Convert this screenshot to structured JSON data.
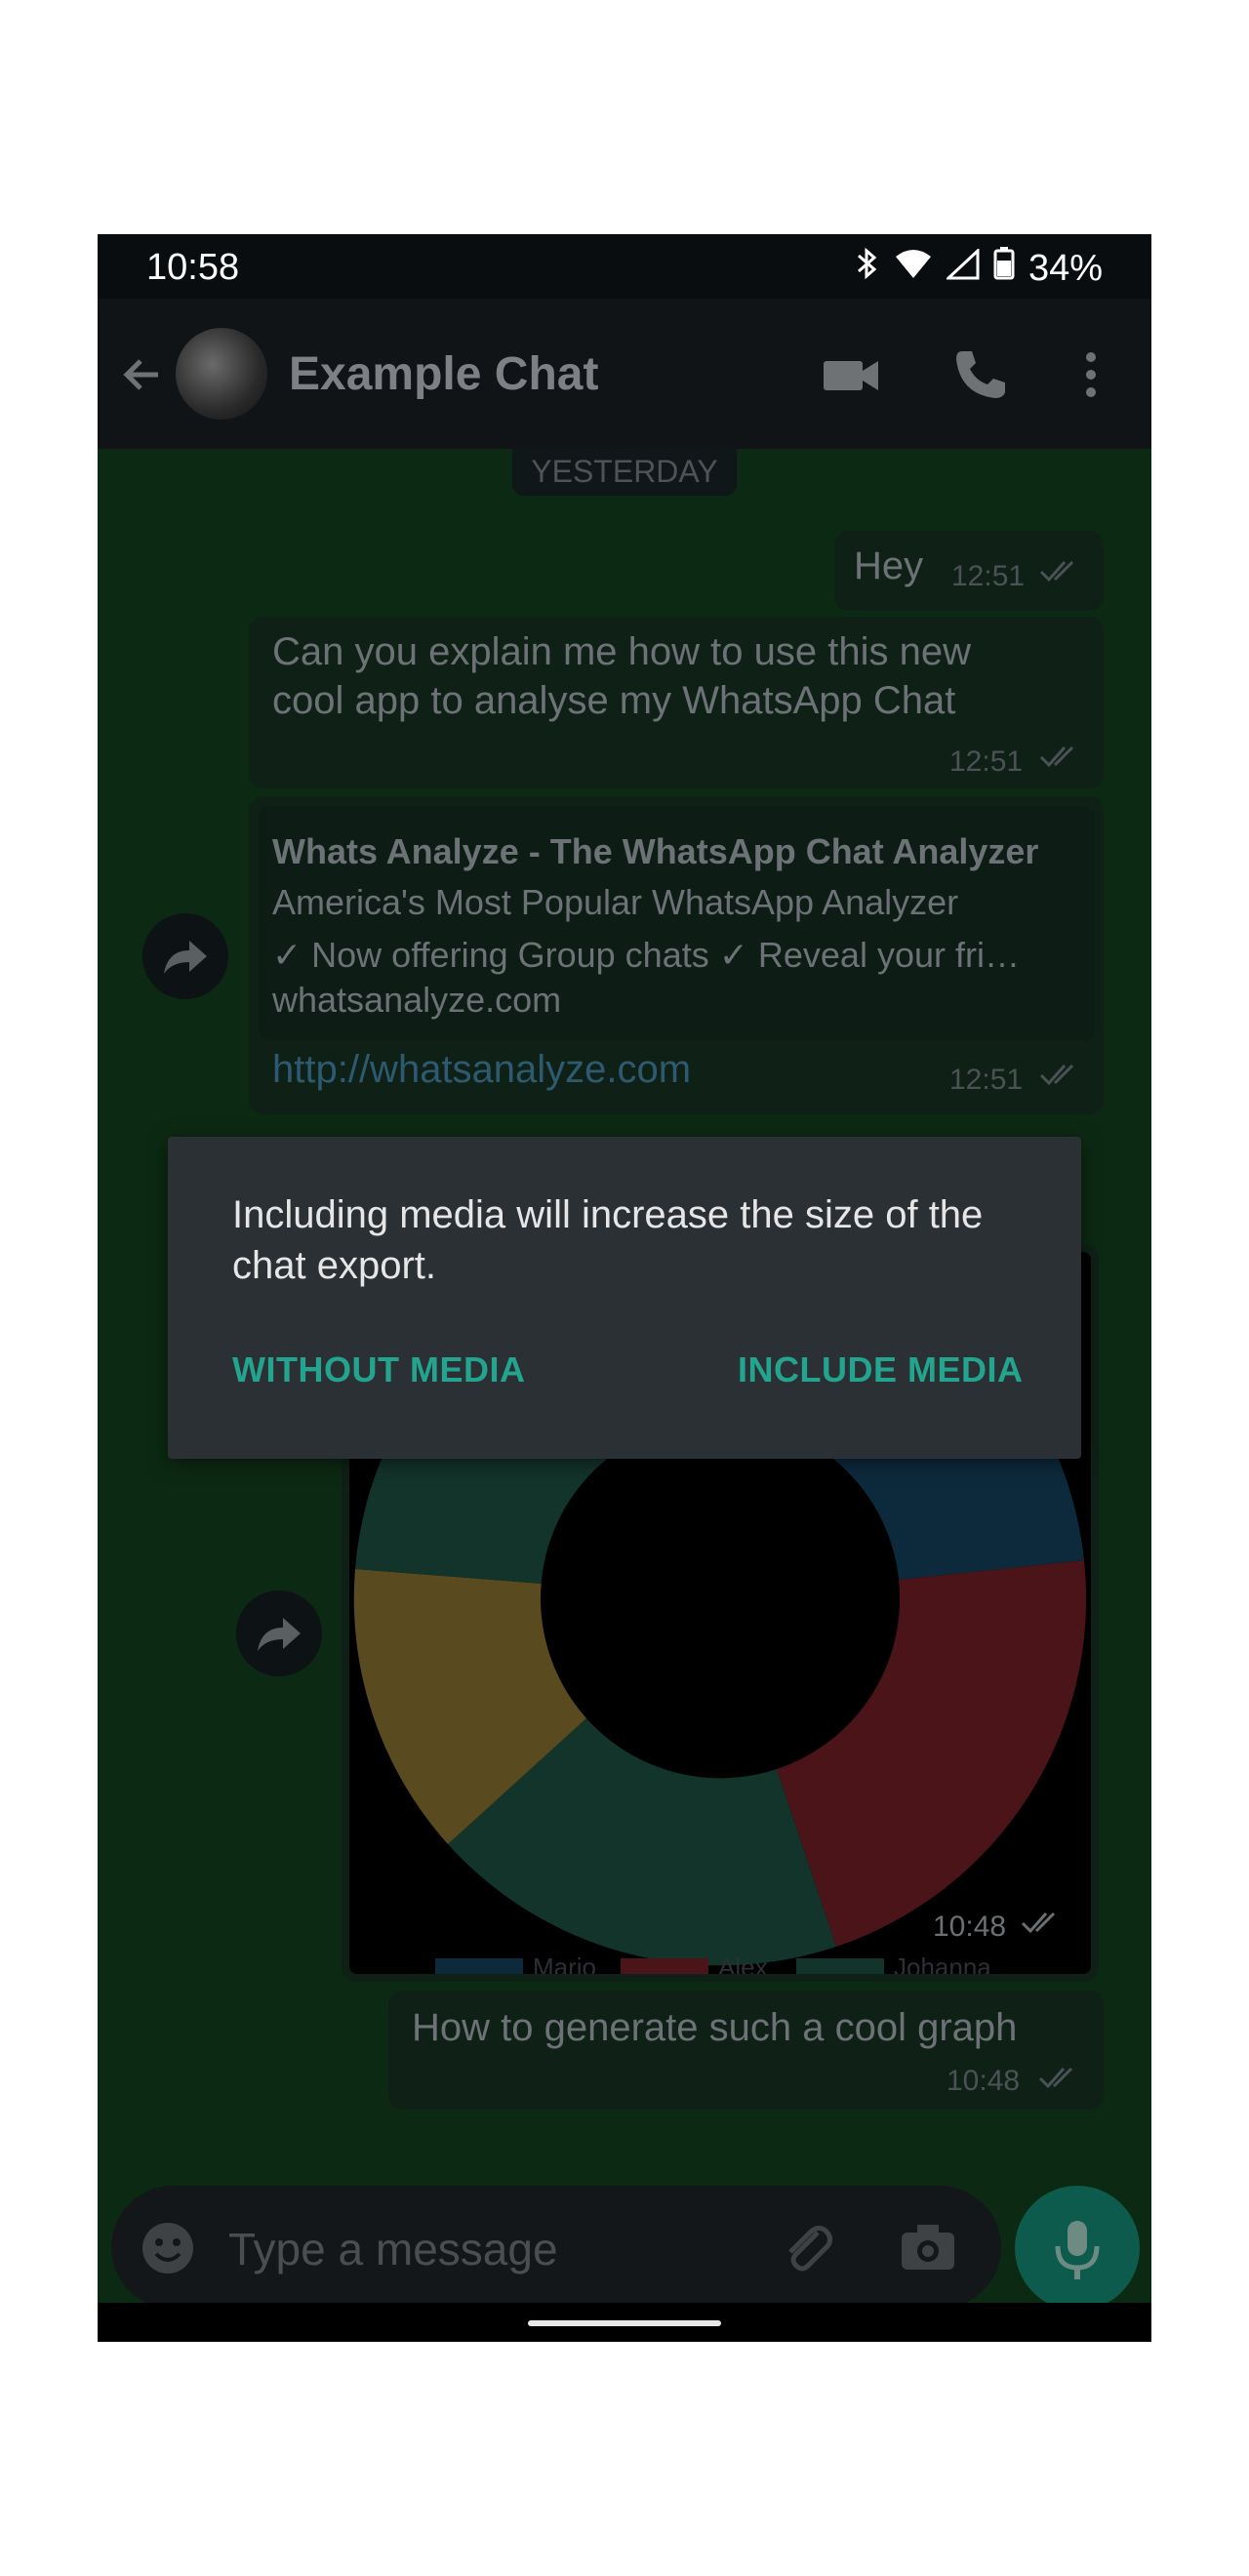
{
  "status": {
    "time": "10:58",
    "battery": "34%"
  },
  "header": {
    "title": "Example Chat"
  },
  "date_pill": "YESTERDAY",
  "messages": {
    "hey": {
      "text": "Hey",
      "time": "12:51"
    },
    "question": {
      "line1": "Can you explain me how to use this new",
      "line2": "cool app to analyse my WhatsApp Chat",
      "time": "12:51"
    },
    "link": {
      "title": "Whats Analyze - The WhatsApp Chat Analyzer",
      "subtitle": "America's Most Popular WhatsApp Analyzer",
      "description": "✓ Now offering Group chats ✓ Reveal your fri…",
      "domain": "whatsanalyze.com",
      "url": "http://whatsanalyze.com",
      "time": "12:51"
    },
    "image": {
      "time": "10:48",
      "legend": [
        "Mario",
        "Alex",
        "Johanna"
      ]
    },
    "graph_q": {
      "text": "How to generate such a cool graph",
      "time": "10:48"
    }
  },
  "dialog": {
    "message": "Including media will increase the size of the chat export.",
    "without_label": "WITHOUT MEDIA",
    "include_label": "INCLUDE MEDIA"
  },
  "composer": {
    "placeholder": "Type a message"
  },
  "colors": {
    "accent": "#23a48f",
    "dialog_bg": "#2b3035"
  }
}
